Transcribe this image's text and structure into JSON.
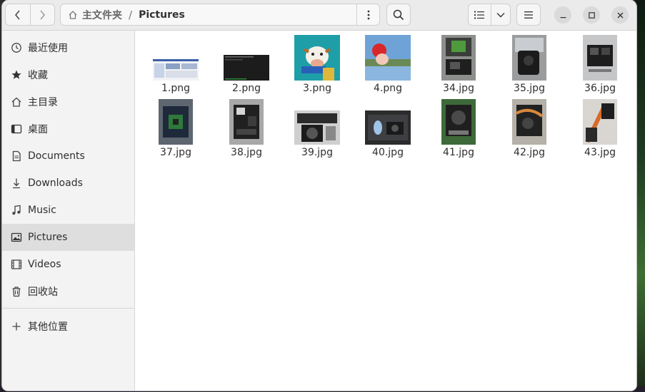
{
  "window": {
    "pathbar": {
      "home_label": "主文件夹",
      "separator": "/",
      "current": "Pictures"
    }
  },
  "sidebar": {
    "items": [
      {
        "label": "最近使用",
        "icon": "clock-icon"
      },
      {
        "label": "收藏",
        "icon": "star-icon"
      },
      {
        "label": "主目录",
        "icon": "home-icon"
      },
      {
        "label": "桌面",
        "icon": "desktop-icon"
      },
      {
        "label": "Documents",
        "icon": "document-icon"
      },
      {
        "label": "Downloads",
        "icon": "download-icon"
      },
      {
        "label": "Music",
        "icon": "music-icon"
      },
      {
        "label": "Pictures",
        "icon": "pictures-icon",
        "active": true
      },
      {
        "label": "Videos",
        "icon": "video-icon"
      },
      {
        "label": "回收站",
        "icon": "trash-icon"
      }
    ],
    "other_locations": {
      "label": "其他位置",
      "icon": "plus-icon"
    }
  },
  "files": [
    {
      "name": "1.png",
      "icon": "screenshot-thumbnail"
    },
    {
      "name": "2.png",
      "icon": "terminal-thumbnail"
    },
    {
      "name": "3.png",
      "icon": "cartoon-cow-thumbnail"
    },
    {
      "name": "4.png",
      "icon": "landscape-thumbnail"
    },
    {
      "name": "34.jpg",
      "icon": "photo-thumbnail"
    },
    {
      "name": "35.jpg",
      "icon": "photo-thumbnail"
    },
    {
      "name": "36.jpg",
      "icon": "photo-thumbnail"
    },
    {
      "name": "37.jpg",
      "icon": "photo-thumbnail"
    },
    {
      "name": "38.jpg",
      "icon": "photo-thumbnail"
    },
    {
      "name": "39.jpg",
      "icon": "photo-thumbnail"
    },
    {
      "name": "40.jpg",
      "icon": "photo-thumbnail"
    },
    {
      "name": "41.jpg",
      "icon": "photo-thumbnail"
    },
    {
      "name": "42.jpg",
      "icon": "photo-thumbnail"
    },
    {
      "name": "43.jpg",
      "icon": "photo-thumbnail"
    }
  ],
  "colors": {
    "sidebar_active": "#dedede",
    "headerbar": "#ebebeb",
    "window_bg": "#ffffff"
  }
}
